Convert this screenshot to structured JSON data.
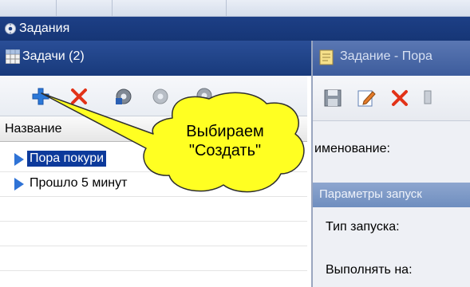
{
  "top_bar": {
    "title": "Задания",
    "icon": "gear-clock-icon"
  },
  "tasks_bar": {
    "title": "Задачи (2)",
    "icon": "grid-icon"
  },
  "left_toolbar": {
    "buttons": [
      {
        "name": "create",
        "icon": "plus-icon",
        "color": "#2b78d8"
      },
      {
        "name": "delete",
        "icon": "red-x-icon",
        "color": "#e23218"
      },
      {
        "name": "settings",
        "icon": "gear-icon"
      },
      {
        "name": "disabled-gear",
        "icon": "gear-disabled-icon"
      },
      {
        "name": "run",
        "icon": "gear-play-icon"
      }
    ]
  },
  "task_list": {
    "column_header": "Название",
    "rows": [
      {
        "label": "Пора покури",
        "selected": true
      },
      {
        "label": "Прошло 5 минут",
        "selected": false
      }
    ]
  },
  "task_window": {
    "title": "Задание - Пора",
    "toolbar_icons": [
      "save-icon",
      "edit-icon",
      "delete-icon"
    ],
    "name_label": "именование:",
    "params_header": "Параметры запуск",
    "launch_type_label": "Тип запуска:",
    "execute_on_label": "Выполнять на:"
  },
  "callout": {
    "text_line1": "Выбираем",
    "text_line2": "\"Создать\"",
    "fill": "#ffff22"
  },
  "colors": {
    "title_bar": "#1d3f86",
    "selection": "#0d3a9b",
    "accent_blue": "#2b78d8"
  }
}
